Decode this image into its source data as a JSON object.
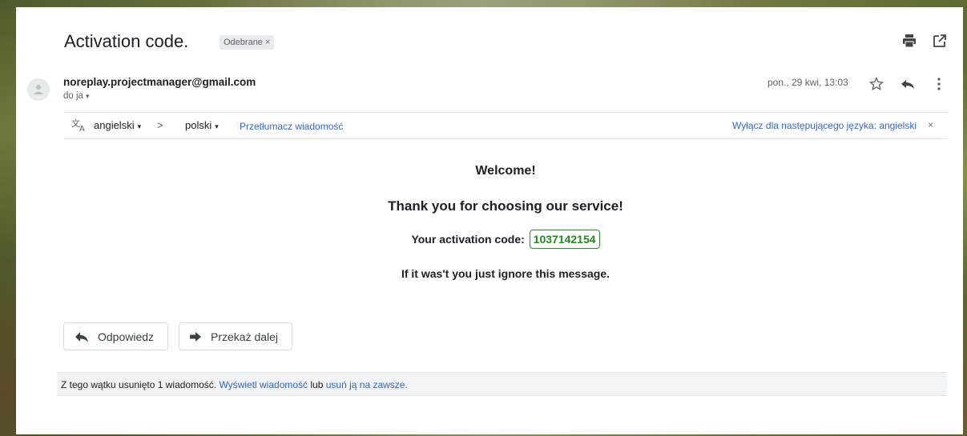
{
  "email": {
    "subject": "Activation code.",
    "label_chip": "Odebrane",
    "label_chip_close": "×",
    "sender": "noreplay.projectmanager@gmail.com",
    "recipient": "do ja",
    "recipient_caret": "▾",
    "date": "pon., 29 kwi, 13:03"
  },
  "translate_bar": {
    "source_language": "angielski",
    "arrow": ">",
    "target_language": "polski",
    "dropdown_caret": "▾",
    "translate_link": "Przetłumacz wiadomość",
    "turn_off_link": "Wyłącz dla następującego języka: angielski",
    "turn_off_close": "×"
  },
  "message": {
    "welcome": "Welcome!",
    "thanks": "Thank you for choosing our service!",
    "code_label": "Your activation code:",
    "code": "1037142154",
    "ignore": "If it was't you just ignore this message."
  },
  "actions": {
    "reply_label": "Odpowiedz",
    "forward_label": "Przekaż dalej"
  },
  "notice": {
    "text": "Z tego wątku usunięto 1 wiadomość.",
    "view_link": "Wyświetl wiadomość",
    "connector": "lub",
    "delete_link": "usuń ją na zawsze."
  },
  "colors": {
    "link": "#3367d6",
    "code_green": "#228822",
    "chip_bg": "#e8eaed",
    "notice_bg": "#f1f3f4"
  },
  "icons": [
    "print-icon",
    "popout-icon",
    "avatar-icon",
    "star-icon",
    "reply-icon",
    "more-vert-icon",
    "translate-icon",
    "reply-arrow-icon",
    "forward-arrow-icon"
  ]
}
